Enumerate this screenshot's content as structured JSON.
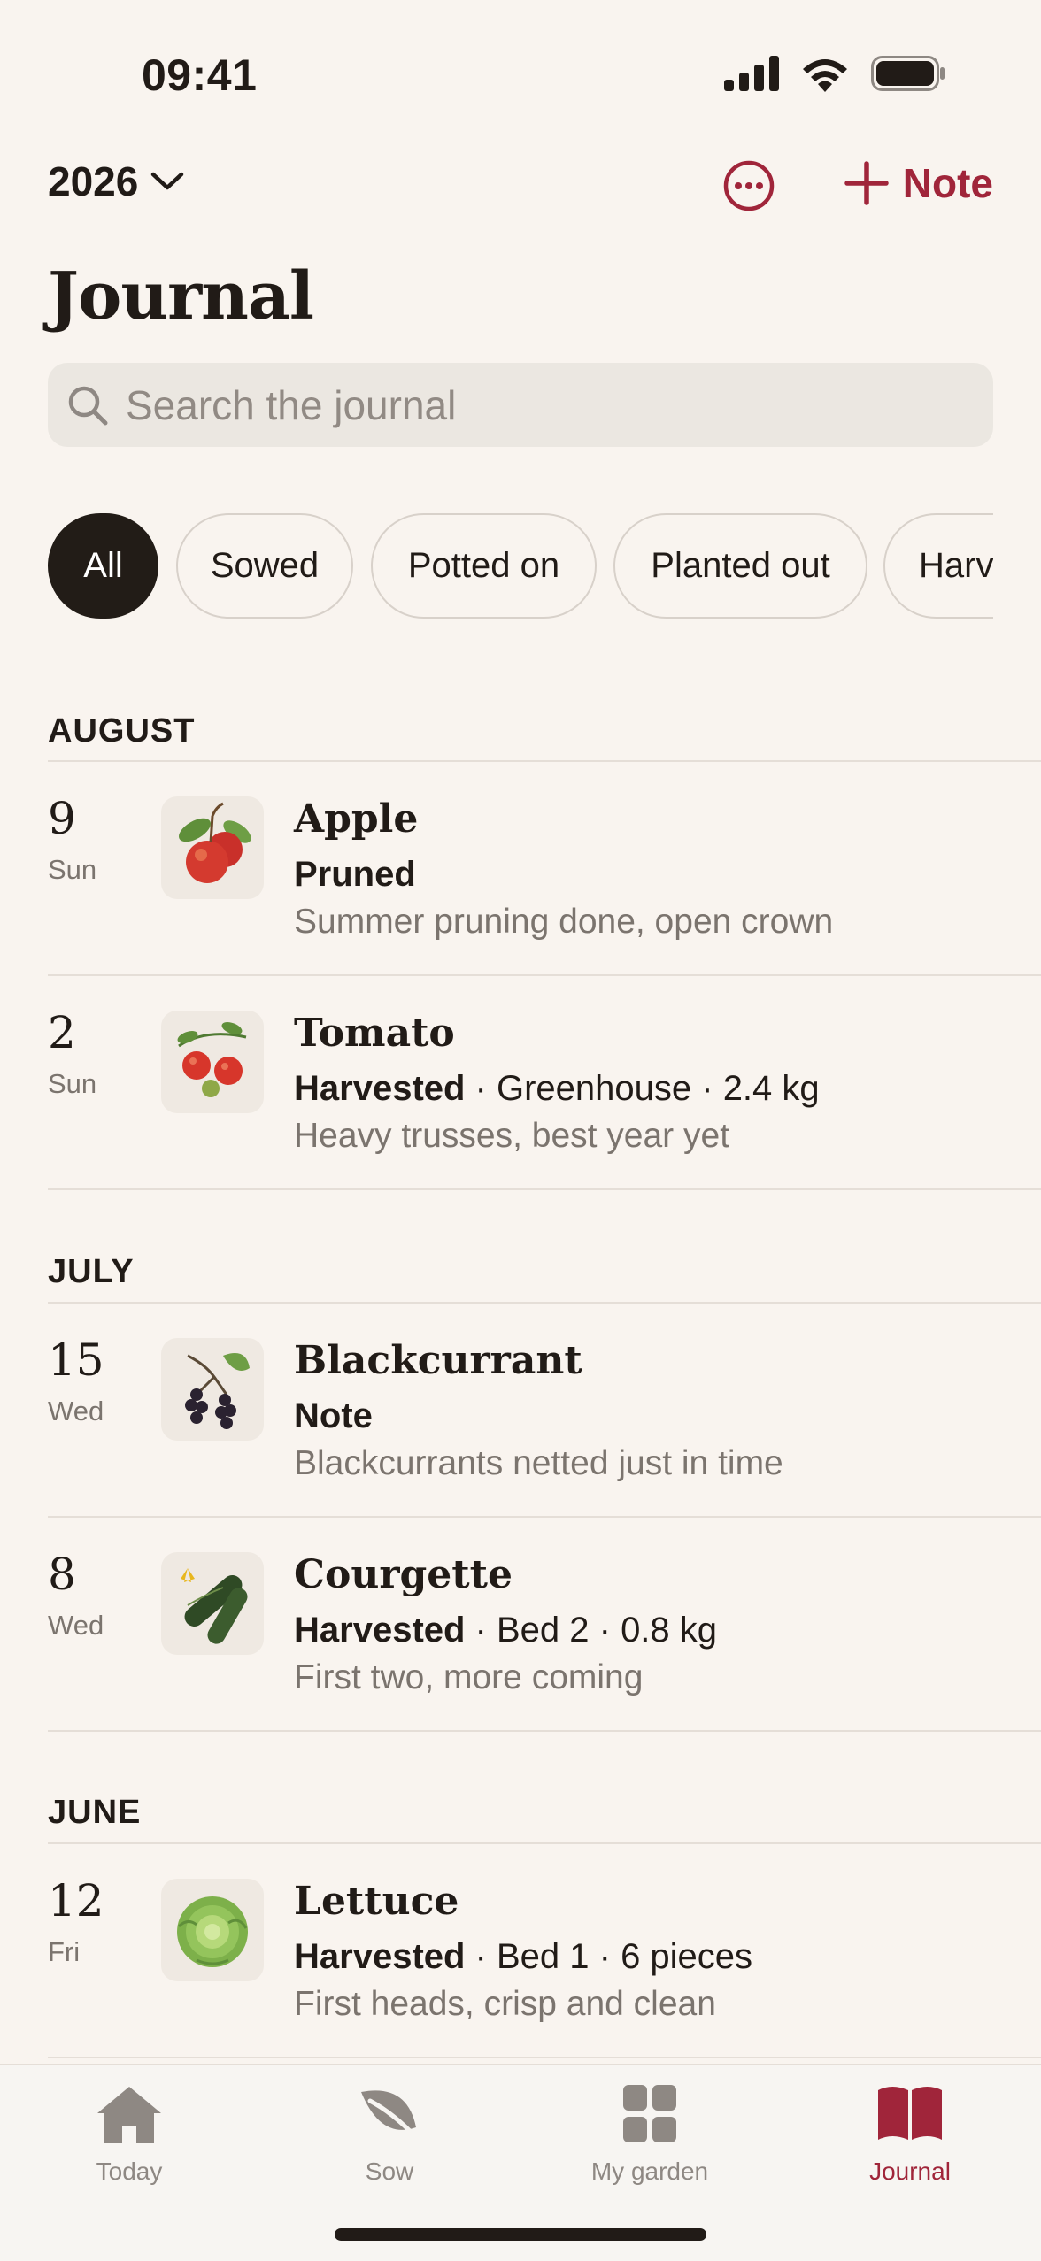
{
  "status_bar": {
    "time": "09:41"
  },
  "header": {
    "year": "2026",
    "note_button": "Note",
    "title": "Journal",
    "search_placeholder": "Search the journal"
  },
  "filters": [
    "All",
    "Sowed",
    "Potted on",
    "Planted out",
    "Harv"
  ],
  "sections": [
    {
      "month": "AUGUST",
      "entries": [
        {
          "day": "9",
          "weekday": "Sun",
          "plant": "Apple",
          "action": "Pruned",
          "details": "",
          "note": "Summer pruning done, open crown",
          "icon": "apple-icon"
        },
        {
          "day": "2",
          "weekday": "Sun",
          "plant": "Tomato",
          "action": "Harvested",
          "details": " · Greenhouse · 2.4 kg",
          "note": "Heavy trusses, best year yet",
          "icon": "tomato-icon"
        }
      ]
    },
    {
      "month": "JULY",
      "entries": [
        {
          "day": "15",
          "weekday": "Wed",
          "plant": "Blackcurrant",
          "action": "Note",
          "details": "",
          "note": "Blackcurrants netted just in time",
          "icon": "blackcurrant-icon"
        },
        {
          "day": "8",
          "weekday": "Wed",
          "plant": "Courgette",
          "action": "Harvested",
          "details": " · Bed 2 · 0.8 kg",
          "note": "First two, more coming",
          "icon": "courgette-icon"
        }
      ]
    },
    {
      "month": "JUNE",
      "entries": [
        {
          "day": "12",
          "weekday": "Fri",
          "plant": "Lettuce",
          "action": "Harvested",
          "details": " · Bed 1 · 6 pieces",
          "note": "First heads, crisp and clean",
          "icon": "lettuce-icon"
        }
      ]
    }
  ],
  "tabs": [
    {
      "label": "Today",
      "icon": "house-icon"
    },
    {
      "label": "Sow",
      "icon": "leaf-icon"
    },
    {
      "label": "My garden",
      "icon": "grid-icon"
    },
    {
      "label": "Journal",
      "icon": "book-icon"
    }
  ],
  "colors": {
    "accent": "#A0253A",
    "background": "#F9F4EF",
    "active_chip": "#221C17"
  }
}
